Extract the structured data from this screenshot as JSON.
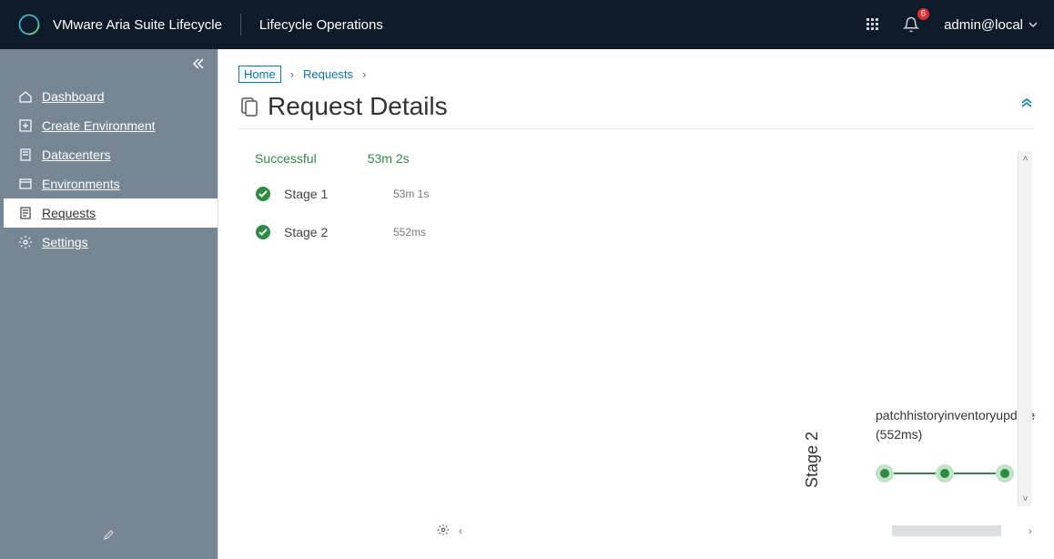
{
  "header": {
    "product": "VMware Aria Suite Lifecycle",
    "section": "Lifecycle Operations",
    "notification_count": "6",
    "user": "admin@local"
  },
  "sidebar": {
    "items": [
      {
        "label": "Dashboard"
      },
      {
        "label": "Create Environment"
      },
      {
        "label": "Datacenters"
      },
      {
        "label": "Environments"
      },
      {
        "label": "Requests"
      },
      {
        "label": "Settings"
      }
    ]
  },
  "breadcrumb": {
    "home": "Home",
    "requests": "Requests"
  },
  "page": {
    "title": "Request Details"
  },
  "overall": {
    "status": "Successful",
    "duration": "53m 2s"
  },
  "stages": [
    {
      "name": "Stage 1",
      "duration": "53m 1s"
    },
    {
      "name": "Stage 2",
      "duration": "552ms"
    }
  ],
  "diagram": {
    "stage_label": "Stage 2",
    "task_name": "patchhistoryinventoryupdate",
    "task_duration": "(552ms)"
  }
}
